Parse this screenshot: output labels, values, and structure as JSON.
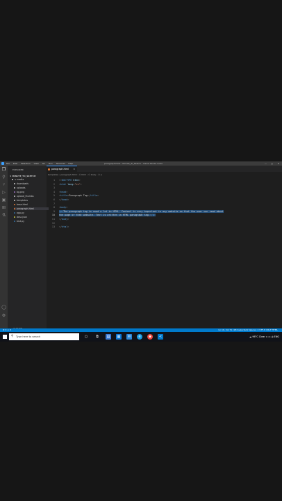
{
  "window": {
    "title": "paragraph.html - Minute_To_Sketch - Visual Studio Code",
    "menu": [
      "File",
      "Edit",
      "Selection",
      "View",
      "Go",
      "Run",
      "Terminal",
      "Help"
    ],
    "controls": [
      "—",
      "□",
      "✕"
    ]
  },
  "sidebar": {
    "header": "EXPLORER",
    "project": "∨ MINUTE_TO_SKETCH",
    "items": [
      {
        "label": "∨ media",
        "color": "#cccccc"
      },
      {
        "label": "downloads",
        "color": "#cccccc"
      },
      {
        "label": "uploads",
        "color": "#cccccc"
      },
      {
        "label": "bg.png",
        "color": "#a074c4"
      },
      {
        "label": "upload_thumbs",
        "color": "#cccccc"
      },
      {
        "label": "templates",
        "color": "#cccccc"
      },
      {
        "label": "base.html",
        "color": "#e37933"
      },
      {
        "label": "paragraph.html",
        "color": "#e37933"
      },
      {
        "label": "app.py",
        "color": "#3572a5"
      },
      {
        "label": "desc.json",
        "color": "#cbcb41"
      },
      {
        "label": "test.py",
        "color": "#3572a5"
      }
    ],
    "outline": "› OUTLINE"
  },
  "editor": {
    "tab_label": "paragraph.html",
    "tab_close": "×",
    "breadcrumb": "templates › paragraph.html › ⬡ html › ⬡ body › ⬡ p",
    "lines": [
      {
        "n": "1",
        "parts": [
          [
            "grey",
            "<!"
          ],
          [
            "tag",
            "DOCTYPE"
          ],
          [
            "attr",
            " html"
          ],
          [
            "grey",
            ">"
          ]
        ]
      },
      {
        "n": "2",
        "parts": [
          [
            "grey",
            "<"
          ],
          [
            "tag",
            "html"
          ],
          [
            "attr",
            " lang"
          ],
          [
            "grey",
            "="
          ],
          [
            "str",
            "\"en\""
          ],
          [
            "grey",
            ">"
          ]
        ]
      },
      {
        "n": "3",
        "parts": []
      },
      {
        "n": "4",
        "parts": [
          [
            "grey",
            "<"
          ],
          [
            "tag",
            "head"
          ],
          [
            "grey",
            ">"
          ]
        ]
      },
      {
        "n": "5",
        "parts": [
          [
            "plain",
            "    "
          ],
          [
            "grey",
            "<"
          ],
          [
            "tag",
            "title"
          ],
          [
            "grey",
            ">"
          ],
          [
            "plain",
            "Paragraph Tag"
          ],
          [
            "grey",
            "</"
          ],
          [
            "tag",
            "title"
          ],
          [
            "grey",
            ">"
          ]
        ]
      },
      {
        "n": "6",
        "parts": [
          [
            "grey",
            "</"
          ],
          [
            "tag",
            "head"
          ],
          [
            "grey",
            ">"
          ]
        ]
      },
      {
        "n": "7",
        "parts": []
      },
      {
        "n": "8",
        "parts": [
          [
            "grey",
            "<"
          ],
          [
            "tag",
            "body"
          ],
          [
            "grey",
            ">"
          ]
        ]
      },
      {
        "n": "9",
        "sel": true,
        "parts": [
          [
            "plain",
            "    "
          ],
          [
            "grey",
            "<"
          ],
          [
            "tag",
            "p"
          ],
          [
            "grey",
            ">"
          ],
          [
            "plain",
            "The paragraph tag is used a lot in HTML. Content is very important in any website so that the user can read about"
          ]
        ]
      },
      {
        "n": "10",
        "sel": true,
        "cur": true,
        "parts": [
          [
            "plain",
            "        the page or that website. Text is written in HTML paragraph tag."
          ],
          [
            "grey",
            "</"
          ],
          [
            "tag",
            "p"
          ],
          [
            "grey",
            ">"
          ]
        ]
      },
      {
        "n": "11",
        "parts": [
          [
            "grey",
            "</"
          ],
          [
            "tag",
            "body"
          ],
          [
            "grey",
            ">"
          ]
        ]
      },
      {
        "n": "12",
        "parts": []
      },
      {
        "n": "13",
        "parts": [
          [
            "grey",
            "</"
          ],
          [
            "tag",
            "html"
          ],
          [
            "grey",
            ">"
          ]
        ]
      }
    ]
  },
  "statusbar": {
    "left": "⊗ 0 ⚠ 0",
    "right": "Ln 10, Col 71 (184 selected)   Spaces: 4   UTF-8   CRLF   HTML"
  },
  "taskbar": {
    "search_placeholder": "Type here to search",
    "tray": "☁ 96°C Clear   ∧  ▭  ◂)   ENG"
  },
  "colors": {
    "accent": "#007acc",
    "selection": "#264f78"
  }
}
